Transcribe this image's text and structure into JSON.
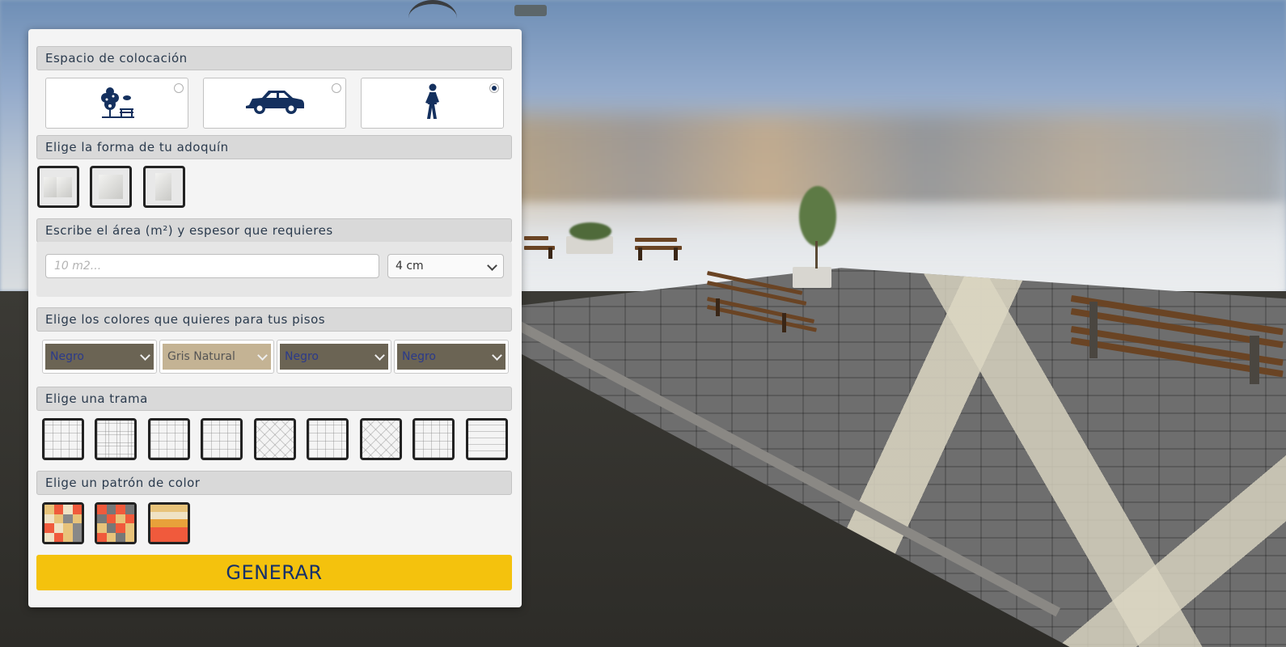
{
  "panel": {
    "sections": {
      "placement": "Espacio de colocación",
      "shape": "Elige la forma de tu adoquín",
      "area": "Escribe el área (m²) y espesor que requieres",
      "colors": "Elige los colores que quieres para tus pisos",
      "pattern": "Elige una trama",
      "color_pattern": "Elige un patrón de color"
    },
    "placement_options": [
      {
        "icon": "park-icon",
        "selected": false
      },
      {
        "icon": "car-icon",
        "selected": false
      },
      {
        "icon": "pedestrian-icon",
        "selected": true
      }
    ],
    "shape_options": [
      "paver-shape-1",
      "paver-shape-2",
      "paver-shape-3"
    ],
    "area_input": {
      "placeholder": "10 m2...",
      "value": ""
    },
    "thickness_select": {
      "selected": "4 cm"
    },
    "color_selects": [
      {
        "selected": "Negro",
        "bg": "#6b6454",
        "fg": "#2b3a8a"
      },
      {
        "selected": "Gris Natural",
        "bg": "#c4b394",
        "fg": "#555555"
      },
      {
        "selected": "Negro",
        "bg": "#6b6454",
        "fg": "#2b3a8a"
      },
      {
        "selected": "Negro",
        "bg": "#6b6454",
        "fg": "#2b3a8a"
      }
    ],
    "pattern_count": 9,
    "color_pattern_count": 3,
    "generate_label": "GENERAR"
  },
  "colors": {
    "accent": "#f4c20d",
    "navy": "#14305e"
  }
}
